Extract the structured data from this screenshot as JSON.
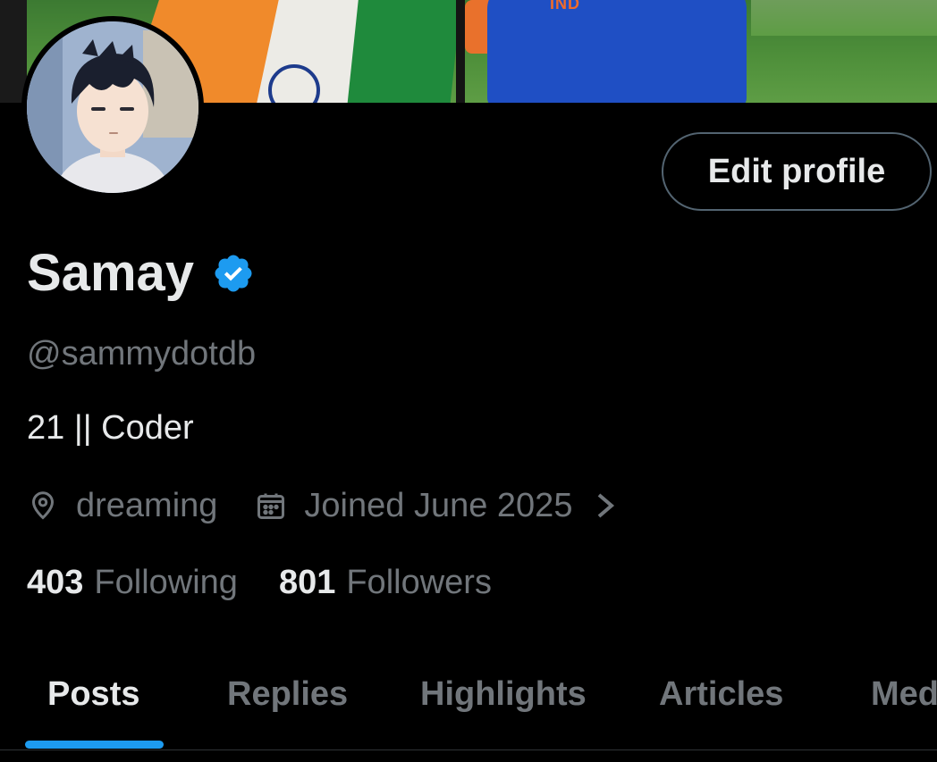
{
  "profile": {
    "display_name": "Samay",
    "handle": "@sammydotdb",
    "bio": "21 || Coder",
    "location": "dreaming",
    "joined": "Joined June 2025",
    "verified": true
  },
  "stats": {
    "following_count": "403",
    "following_label": "Following",
    "followers_count": "801",
    "followers_label": "Followers"
  },
  "actions": {
    "edit_profile_label": "Edit profile"
  },
  "banner": {
    "jersey_text": "IND"
  },
  "tabs": [
    {
      "label": "Posts",
      "active": true
    },
    {
      "label": "Replies",
      "active": false
    },
    {
      "label": "Highlights",
      "active": false
    },
    {
      "label": "Articles",
      "active": false
    },
    {
      "label": "Med",
      "active": false
    }
  ],
  "icons": {
    "verified": "verified-badge-icon",
    "location": "location-pin-icon",
    "calendar": "calendar-icon",
    "chevron": "chevron-right-icon"
  },
  "colors": {
    "background": "#000000",
    "text_primary": "#e7e9ea",
    "text_secondary": "#71767b",
    "accent": "#1d9bf0",
    "border": "#536471"
  }
}
